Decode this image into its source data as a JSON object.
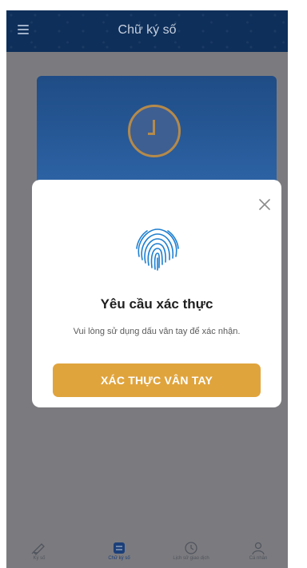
{
  "header": {
    "title": "Chữ ký số",
    "menu_icon": "hamburger-menu-icon",
    "background_color": "#0e2f5a"
  },
  "background_card": {
    "icon": "clock-icon",
    "color": "#2e65a8"
  },
  "modal": {
    "title": "Yêu cầu xác thực",
    "message": "Vui lòng sử dụng dấu vân tay để xác nhận.",
    "button_label": "XÁC THỰC VÂN TAY",
    "button_color": "#e0a43d",
    "icon": "fingerprint-icon",
    "close_icon": "close-icon",
    "fingerprint_color": "#1e7fd0"
  },
  "tabbar": {
    "items": [
      {
        "label": "Ký số",
        "icon": "pen-signature-icon",
        "active": false
      },
      {
        "label": "Chữ ký số",
        "icon": "digital-signature-icon",
        "active": true
      },
      {
        "label": "Lịch sử giao dịch",
        "icon": "history-clock-icon",
        "active": false
      },
      {
        "label": "Cá nhân",
        "icon": "user-icon",
        "active": false
      }
    ]
  }
}
